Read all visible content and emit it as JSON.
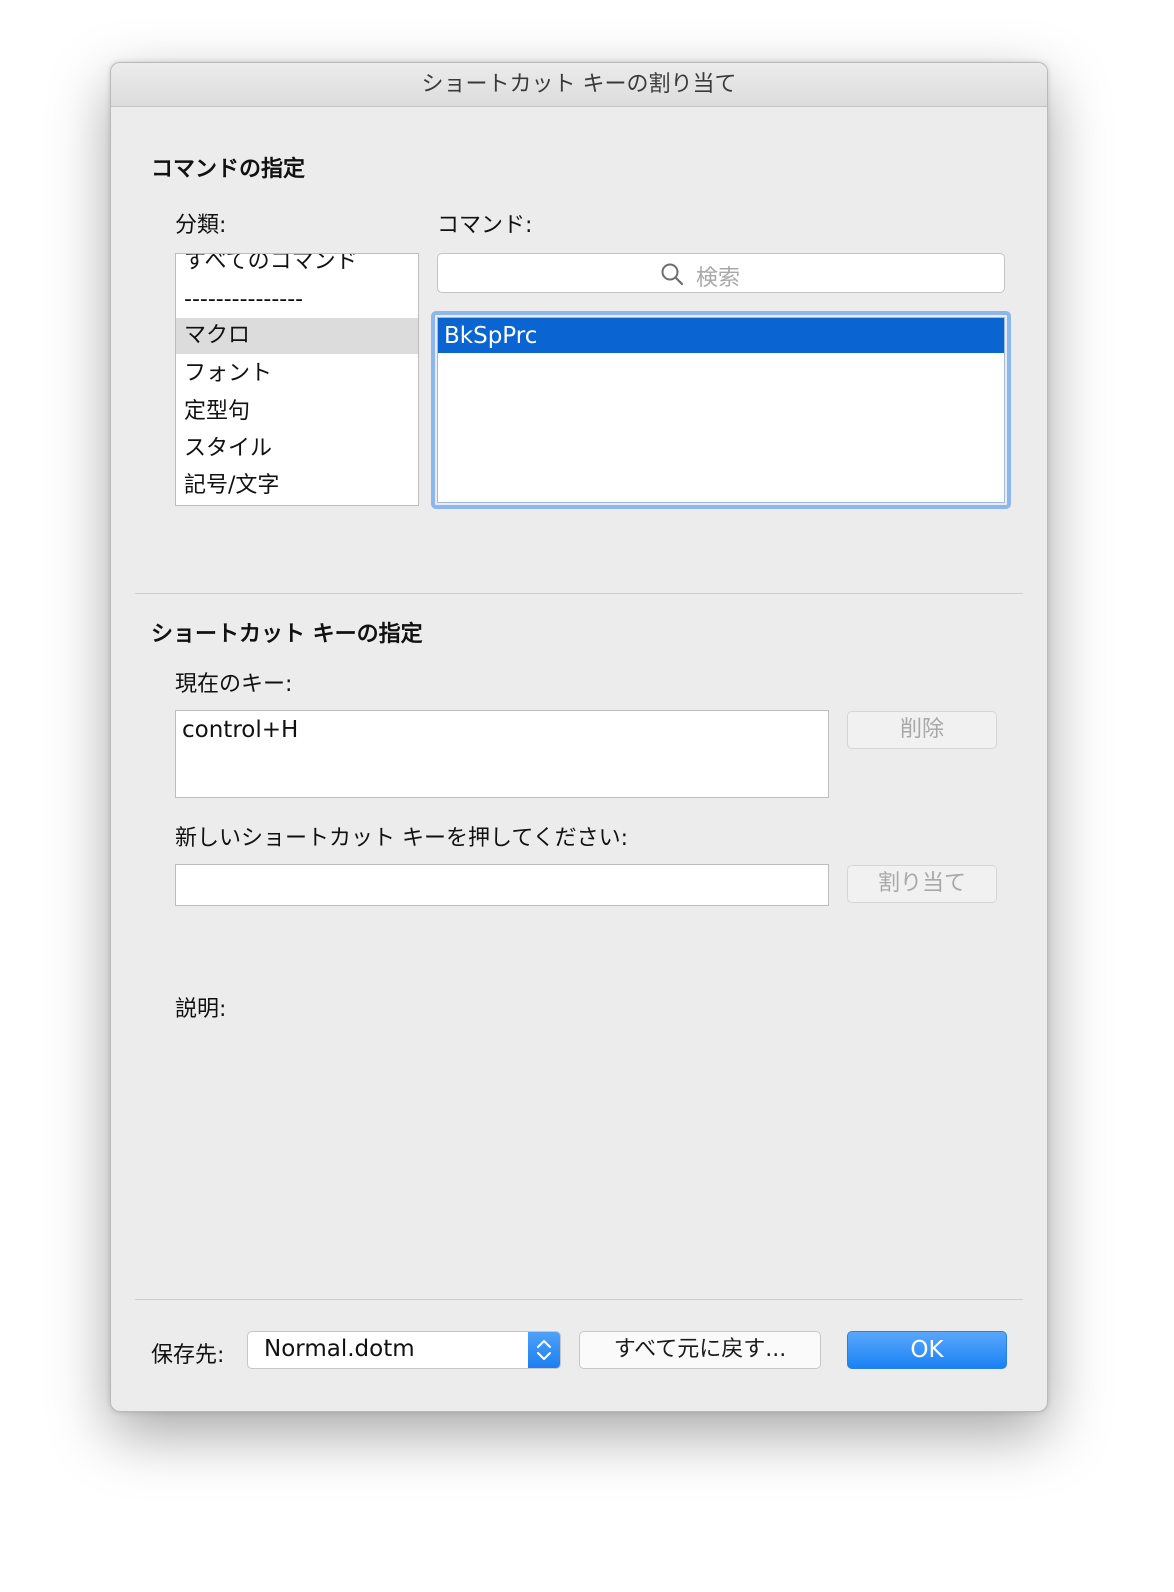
{
  "window": {
    "title": "ショートカット キーの割り当て"
  },
  "command_section": {
    "title": "コマンドの指定",
    "category_label": "分類:",
    "command_label": "コマンド:",
    "categories": [
      {
        "label": "すべてのコマンド"
      },
      {
        "label": "---------------"
      },
      {
        "label": "マクロ",
        "selected": true
      },
      {
        "label": "フォント"
      },
      {
        "label": "定型句"
      },
      {
        "label": "スタイル"
      },
      {
        "label": "記号/文字"
      }
    ],
    "search": {
      "placeholder": "検索",
      "icon": "magnifier-icon"
    },
    "commands": [
      {
        "label": "BkSpPrc",
        "selected": true
      }
    ]
  },
  "shortcut_section": {
    "title": "ショートカット キーの指定",
    "current_keys_label": "現在のキー:",
    "current_keys_value": "control+H",
    "remove_button": "削除",
    "new_key_label": "新しいショートカット キーを押してください:",
    "new_key_value": "",
    "assign_button": "割り当て",
    "description_label": "説明:"
  },
  "footer": {
    "save_in_label": "保存先:",
    "save_in_value": "Normal.dotm",
    "reset_all_button": "すべて元に戻す...",
    "ok_button": "OK"
  },
  "colors": {
    "selection_blue": "#0a64d2",
    "primary_button": "#1a82f5",
    "focus_ring": "#8cb7ee"
  }
}
